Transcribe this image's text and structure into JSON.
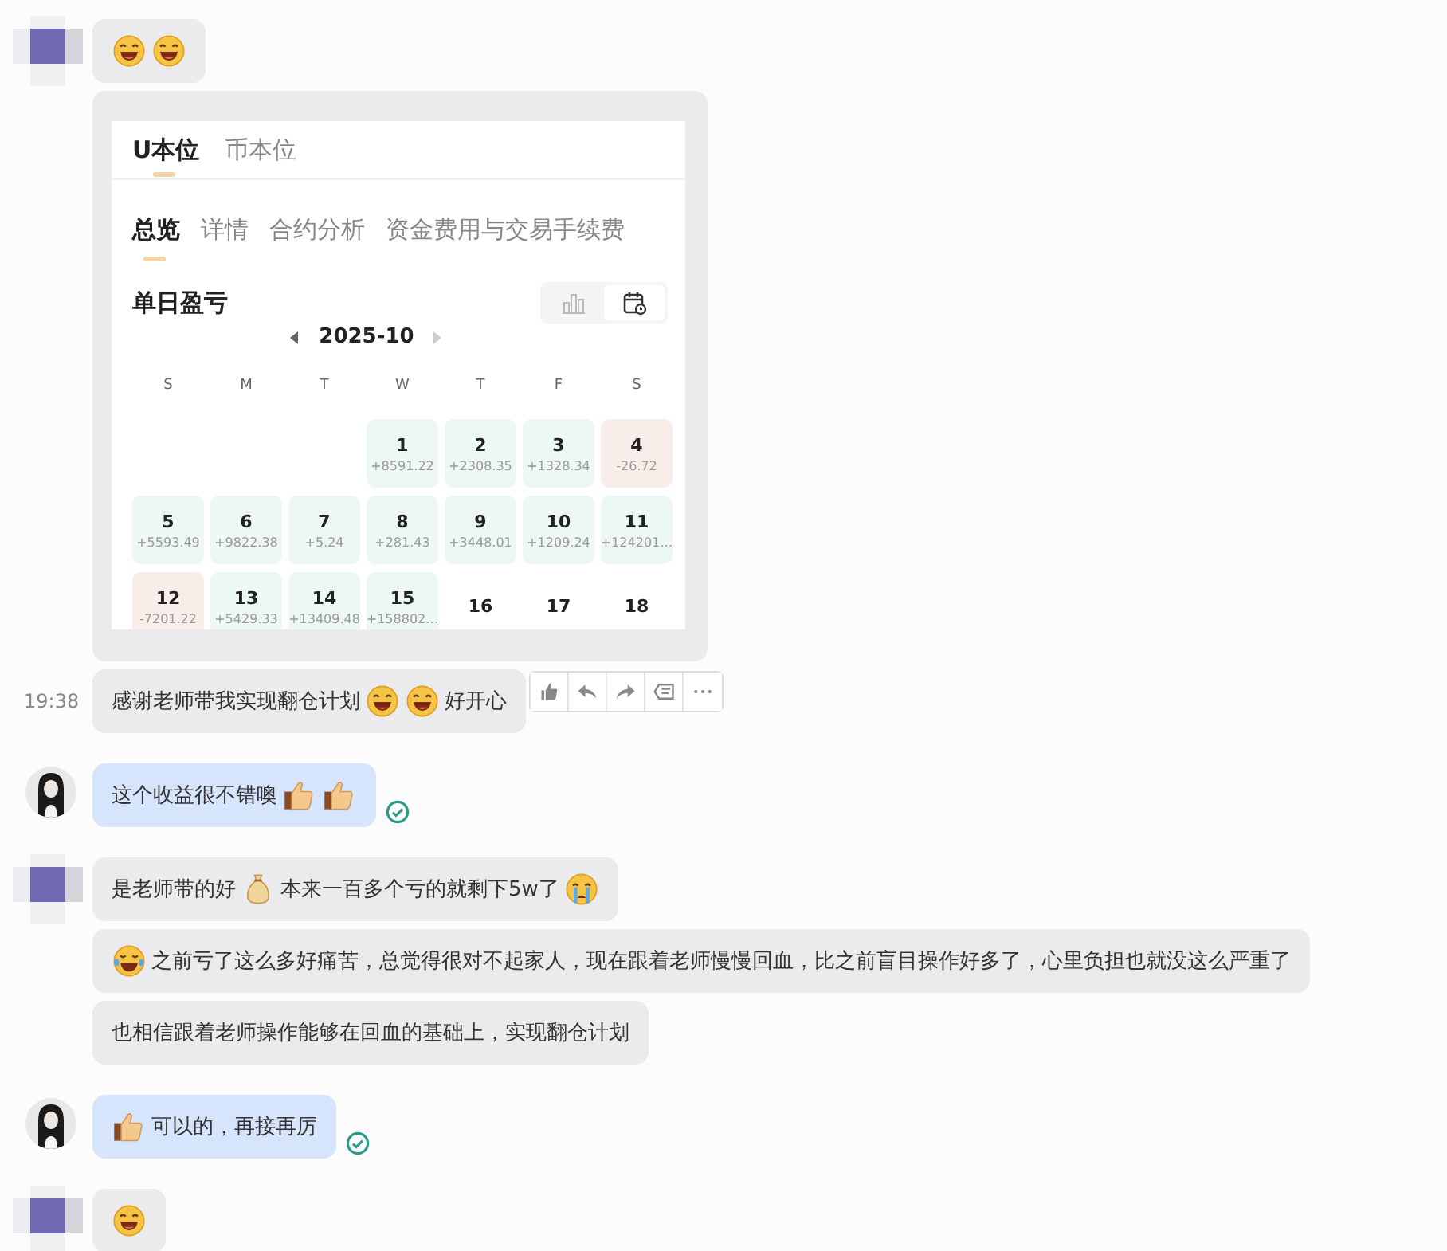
{
  "messages": [
    {
      "outgoing": false,
      "avatar": {
        "kind": "mosaic"
      },
      "kind": "bubble",
      "content": [
        {
          "kind": "grin"
        },
        {
          "kind": "grin"
        }
      ]
    },
    {
      "kind": "screenshot",
      "screenshot": {
        "tabs": [
          {
            "label": "U本位",
            "selected": true
          },
          {
            "label": "币本位",
            "selected": false
          }
        ],
        "subtabs": [
          {
            "label": "总览",
            "selected": true
          },
          {
            "label": "详情",
            "selected": false
          },
          {
            "label": "合约分析",
            "selected": false
          },
          {
            "label": "资金费用与交易手续费",
            "selected": false
          }
        ],
        "title": "单日盈亏",
        "view_toggle": [
          {
            "kind": "bar",
            "selected": false
          },
          {
            "kind": "calendar",
            "selected": true
          }
        ],
        "month": {
          "label": "2025-10",
          "next_enabled": false
        },
        "weekdays": [
          "S",
          "M",
          "T",
          "W",
          "T",
          "F",
          "S"
        ],
        "weeks": [
          {
            "cells": [
              {
                "kind": "blank"
              },
              {
                "kind": "blank"
              },
              {
                "kind": "blank"
              },
              {
                "kind": "gain",
                "day": "1",
                "value": "+8591.22"
              },
              {
                "kind": "gain",
                "day": "2",
                "value": "+2308.35"
              },
              {
                "kind": "gain",
                "day": "3",
                "value": "+1328.34"
              },
              {
                "kind": "loss",
                "day": "4",
                "value": "-26.72"
              }
            ]
          },
          {
            "cells": [
              {
                "kind": "gain",
                "day": "5",
                "value": "+5593.49"
              },
              {
                "kind": "gain",
                "day": "6",
                "value": "+9822.38"
              },
              {
                "kind": "gain",
                "day": "7",
                "value": "+5.24"
              },
              {
                "kind": "gain",
                "day": "8",
                "value": "+281.43"
              },
              {
                "kind": "gain",
                "day": "9",
                "value": "+3448.01"
              },
              {
                "kind": "gain",
                "day": "10",
                "value": "+1209.24"
              },
              {
                "kind": "gain",
                "day": "11",
                "value": "+124201…"
              }
            ]
          },
          {
            "cells": [
              {
                "kind": "loss",
                "day": "12",
                "value": "-7201.22"
              },
              {
                "kind": "gain",
                "day": "13",
                "value": "+5429.33"
              },
              {
                "kind": "gain",
                "day": "14",
                "value": "+13409.48"
              },
              {
                "kind": "gain",
                "day": "15",
                "value": "+158802…"
              },
              {
                "kind": "plain",
                "day": "16"
              },
              {
                "kind": "plain",
                "day": "17"
              },
              {
                "kind": "plain",
                "day": "18"
              }
            ]
          }
        ]
      }
    },
    {
      "outgoing": false,
      "kind": "bubble",
      "time": "19:38",
      "show_actions": true,
      "content": [
        {
          "kind": "text",
          "text": "感谢老师带我实现翻仓计划"
        },
        {
          "kind": "grin"
        },
        {
          "kind": "grin"
        },
        {
          "kind": "text",
          "text": "好开心"
        }
      ]
    },
    {
      "outgoing": true,
      "avatar": {
        "kind": "photo"
      },
      "kind": "bubble",
      "read": true,
      "content": [
        {
          "kind": "text",
          "text": "这个收益很不错噢"
        },
        {
          "kind": "thumb"
        },
        {
          "kind": "thumb"
        }
      ]
    },
    {
      "outgoing": false,
      "avatar": {
        "kind": "mosaic"
      },
      "kind": "bubble",
      "content": [
        {
          "kind": "text",
          "text": "是老师带的好"
        },
        {
          "kind": "moneybag"
        },
        {
          "kind": "text",
          "text": "本来一百多个亏的就剩下5w了"
        },
        {
          "kind": "cry"
        }
      ]
    },
    {
      "outgoing": false,
      "kind": "bubble",
      "content": [
        {
          "kind": "crylaugh"
        },
        {
          "kind": "text",
          "text": "之前亏了这么多好痛苦，总觉得很对不起家人，现在跟着老师慢慢回血，比之前盲目操作好多了，心里负担也就没这么严重了"
        }
      ]
    },
    {
      "outgoing": false,
      "kind": "bubble",
      "content": [
        {
          "kind": "text",
          "text": "也相信跟着老师操作能够在回血的基础上，实现翻仓计划"
        }
      ]
    },
    {
      "outgoing": true,
      "avatar": {
        "kind": "photo"
      },
      "kind": "bubble",
      "read": true,
      "content": [
        {
          "kind": "thumb"
        },
        {
          "kind": "text",
          "text": "可以的，再接再厉"
        }
      ]
    },
    {
      "outgoing": false,
      "avatar": {
        "kind": "mosaic"
      },
      "kind": "bubble",
      "content": [
        {
          "kind": "grin"
        }
      ]
    }
  ]
}
